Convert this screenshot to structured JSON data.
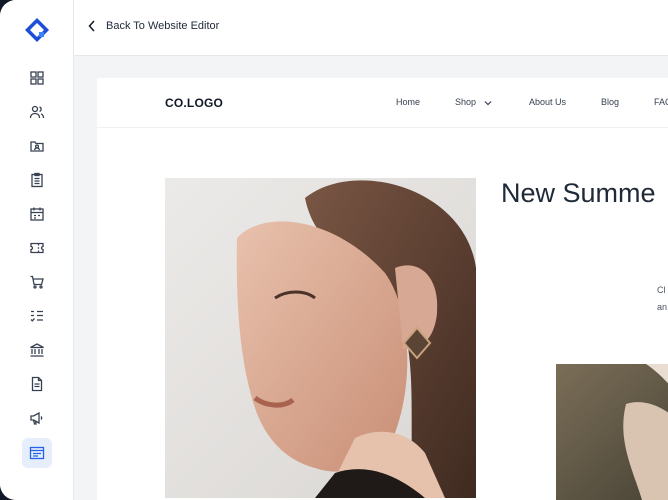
{
  "topbar": {
    "back_label": "Back To Website Editor"
  },
  "sidebar": {
    "items": [
      {
        "icon": "dashboard-icon"
      },
      {
        "icon": "users-icon"
      },
      {
        "icon": "folder-user-icon"
      },
      {
        "icon": "clipboard-icon"
      },
      {
        "icon": "calendar-icon"
      },
      {
        "icon": "ticket-icon"
      },
      {
        "icon": "cart-icon"
      },
      {
        "icon": "checklist-icon"
      },
      {
        "icon": "bank-icon"
      },
      {
        "icon": "document-icon"
      },
      {
        "icon": "megaphone-icon"
      },
      {
        "icon": "browser-window-icon",
        "active": true
      }
    ],
    "accent": "#2563eb"
  },
  "site": {
    "logo": "CO.LOGO",
    "nav": [
      "Home",
      "Shop",
      "About Us",
      "Blog",
      "FAQ"
    ],
    "headline": "New Summe",
    "snippet_1": "Cl",
    "snippet_2": "an"
  }
}
